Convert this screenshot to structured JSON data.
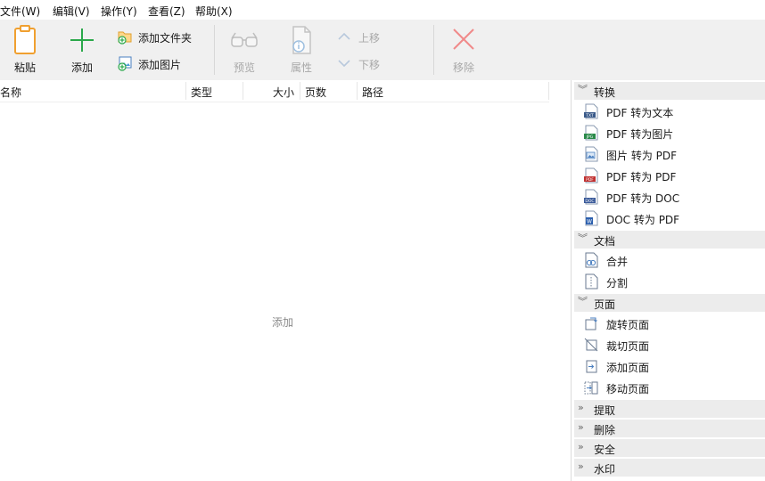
{
  "menu": [
    "文件(W)",
    "编辑(V)",
    "操作(Y)",
    "查看(Z)",
    "帮助(X)"
  ],
  "toolbar": {
    "paste": "粘贴",
    "add": "添加",
    "add_folder": "添加文件夹",
    "add_image": "添加图片",
    "preview": "预览",
    "properties": "属性",
    "move_up": "上移",
    "move_down": "下移",
    "remove": "移除"
  },
  "columns": [
    "名称",
    "类型",
    "大小",
    "页数",
    "路径"
  ],
  "empty_hint": "添加",
  "panel": {
    "groups": [
      {
        "title": "转换",
        "expanded": true,
        "items": [
          {
            "label": "PDF 转为文本",
            "icon": "txt-file-icon"
          },
          {
            "label": "PDF 转为图片",
            "icon": "jpg-file-icon"
          },
          {
            "label": "图片 转为 PDF",
            "icon": "image-file-icon"
          },
          {
            "label": "PDF 转为 PDF",
            "icon": "pdf-file-icon"
          },
          {
            "label": "PDF 转为 DOC",
            "icon": "doc-file-icon"
          },
          {
            "label": "DOC 转为 PDF",
            "icon": "word-file-icon"
          }
        ]
      },
      {
        "title": "文档",
        "expanded": true,
        "items": [
          {
            "label": "合并",
            "icon": "merge-icon"
          },
          {
            "label": "分割",
            "icon": "split-icon"
          }
        ]
      },
      {
        "title": "页面",
        "expanded": true,
        "items": [
          {
            "label": "旋转页面",
            "icon": "rotate-page-icon"
          },
          {
            "label": "裁切页面",
            "icon": "crop-page-icon"
          },
          {
            "label": "添加页面",
            "icon": "add-page-icon"
          },
          {
            "label": "移动页面",
            "icon": "move-page-icon"
          }
        ]
      },
      {
        "title": "提取",
        "expanded": false,
        "items": []
      },
      {
        "title": "删除",
        "expanded": false,
        "items": []
      },
      {
        "title": "安全",
        "expanded": false,
        "items": []
      },
      {
        "title": "水印",
        "expanded": false,
        "items": []
      }
    ]
  },
  "colors": {
    "toolbar_bg": "#f0f0f0",
    "group_header_bg": "#ececec",
    "accent_green": "#2aa84a",
    "paste_orange": "#f0a030",
    "remove_red": "#f08a8a",
    "disabled_text": "#a8a8a8"
  }
}
